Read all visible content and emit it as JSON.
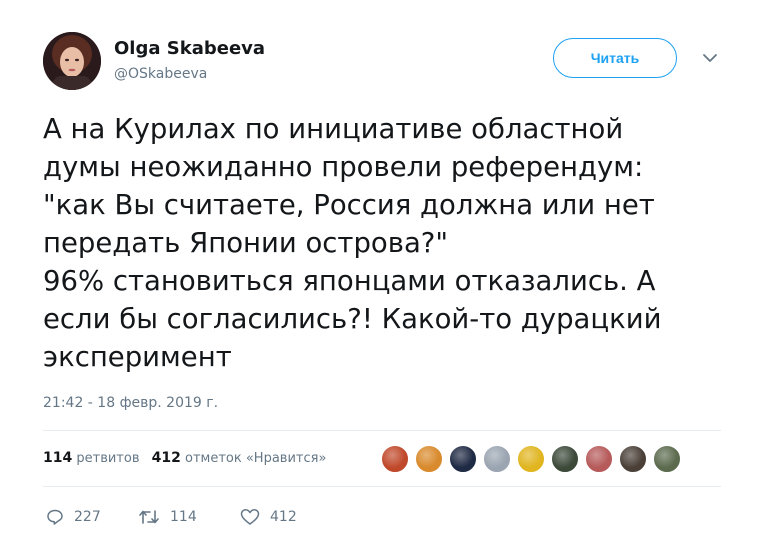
{
  "author": {
    "name": "Olga Skabeeva",
    "handle": "@OSkabeeva"
  },
  "header": {
    "follow_label": "Читать",
    "caret_icon": "chevron-down-icon"
  },
  "tweet": {
    "text": "А на Курилах по инициативе областной\nдумы неожиданно провели референдум:\n\"как Вы считаете, Россия должна или нет\nпередать Японии острова?\"\n96% становиться японцами отказались. А\nесли бы согласились?! Какой-то дурацкий\nэксперимент",
    "timestamp": "21:42 - 18 февр. 2019 г."
  },
  "stats": {
    "retweets_count": "114",
    "retweets_label": "ретвитов",
    "likes_count": "412",
    "likes_label": "отметок «Нравится»"
  },
  "likers": [
    {
      "color": "#c0492b"
    },
    {
      "color": "#d98a2c"
    },
    {
      "color": "#1f2a44"
    },
    {
      "color": "#9aa5b1"
    },
    {
      "color": "#e0b520"
    },
    {
      "color": "#3d4a3a"
    },
    {
      "color": "#b65a5a"
    },
    {
      "color": "#4a4038"
    },
    {
      "color": "#5c6b4e"
    }
  ],
  "actions": {
    "reply_count": "227",
    "retweet_count": "114",
    "like_count": "412"
  },
  "colors": {
    "accent": "#1da1f2",
    "muted": "#657786",
    "divider": "#e6ecf0"
  }
}
